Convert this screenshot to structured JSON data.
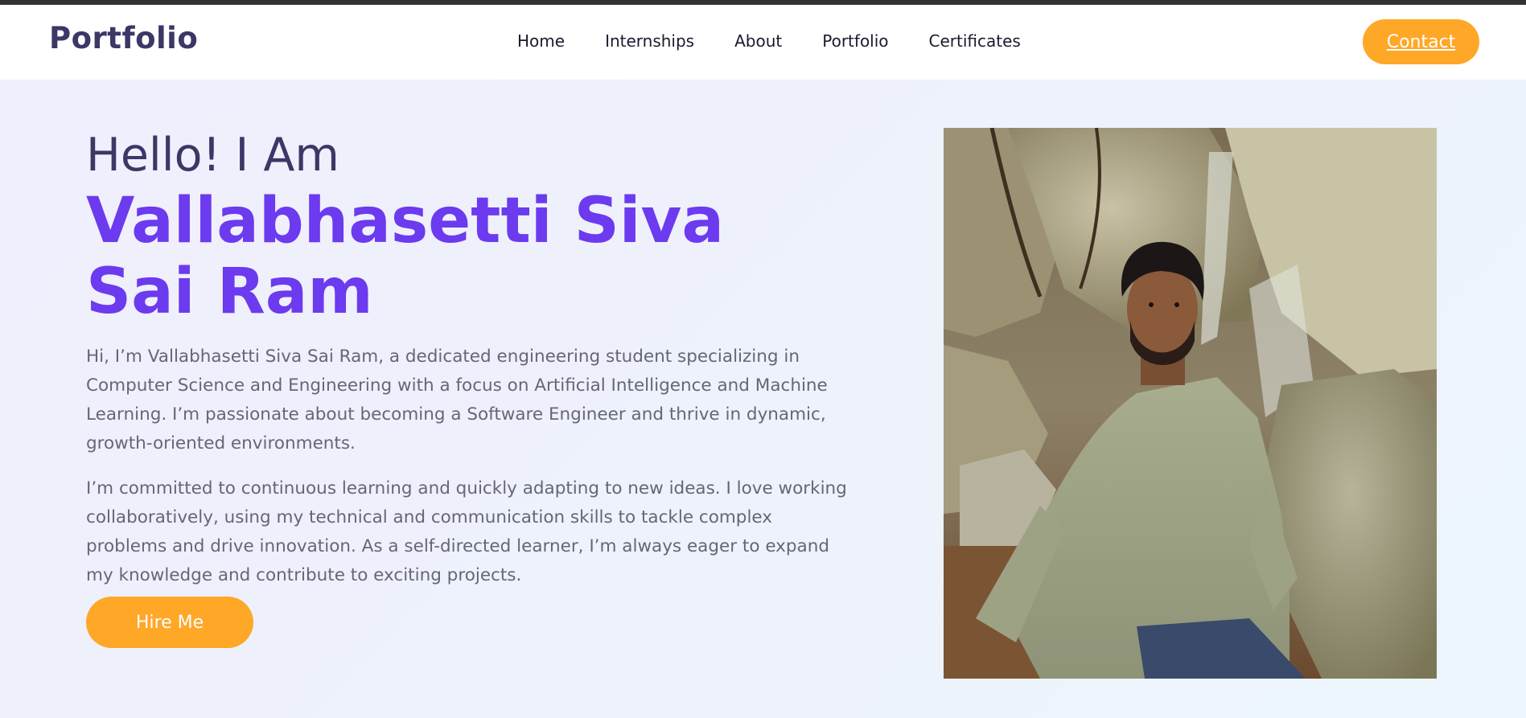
{
  "header": {
    "brand": "Portfolio",
    "nav": [
      "Home",
      "Internships",
      "About",
      "Portfolio",
      "Certificates"
    ],
    "contact_label": "Contact"
  },
  "hero": {
    "greeting": "Hello! I Am",
    "name": "Vallabhasetti Siva Sai Ram",
    "bio_1": "Hi, I’m Vallabhasetti Siva Sai Ram, a dedicated engineering student specializing in Computer Science and Engineering with a focus on Artificial Intelligence and Machine Learning. I’m passionate about becoming a Software Engineer and thrive in dynamic, growth-oriented environments.",
    "bio_2": "I’m committed to continuous learning and quickly adapting to new ideas. I love working collaboratively, using my technical and communication skills to tackle complex problems and drive innovation. As a self-directed learner, I’m always eager to expand my knowledge and contribute to exciting projects.",
    "hire_label": "Hire Me"
  },
  "colors": {
    "accent_orange": "#ffa726",
    "name_purple": "#6c3aef",
    "brand_navy": "#3b3766",
    "body_text": "#666677"
  }
}
